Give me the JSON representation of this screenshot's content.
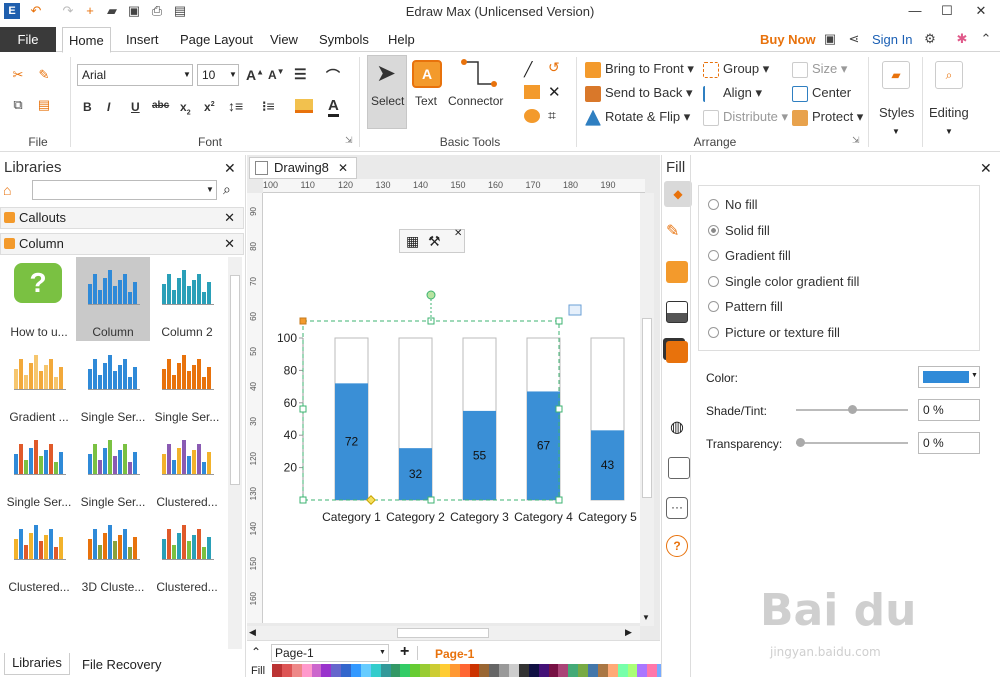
{
  "app": {
    "title": "Edraw Max (Unlicensed Version)"
  },
  "menu": {
    "file": "File",
    "tabs": [
      "Home",
      "Insert",
      "Page Layout",
      "View",
      "Symbols",
      "Help"
    ],
    "buy_now": "Buy Now",
    "sign_in": "Sign In"
  },
  "ribbon": {
    "font_family": "Arial",
    "font_size": "10",
    "groups": {
      "file": "File",
      "font": "Font",
      "basic_tools": "Basic Tools",
      "arrange": "Arrange"
    },
    "tools": {
      "select": "Select",
      "text": "Text",
      "connector": "Connector"
    },
    "arrange": {
      "bring_front": "Bring to Front",
      "send_back": "Send to Back",
      "rotate_flip": "Rotate & Flip",
      "group": "Group",
      "align": "Align",
      "distribute": "Distribute",
      "size": "Size",
      "center": "Center",
      "protect": "Protect"
    },
    "styles": "Styles",
    "editing": "Editing"
  },
  "libraries": {
    "title": "Libraries",
    "sections": [
      "Callouts",
      "Column"
    ],
    "items": [
      "How to u...",
      "Column",
      "Column 2",
      "Gradient ...",
      "Single Ser...",
      "Single Ser...",
      "Single Ser...",
      "Single Ser...",
      "Clustered...",
      "Clustered...",
      "3D Cluste...",
      "Clustered..."
    ],
    "bottom_tabs": [
      "Libraries",
      "File Recovery"
    ]
  },
  "document": {
    "tab": "Drawing8",
    "ruler_h": [
      "100",
      "110",
      "120",
      "130",
      "140",
      "150",
      "160",
      "170",
      "180",
      "190"
    ],
    "ruler_v": [
      "90",
      "80",
      "70",
      "60",
      "50",
      "40",
      "30",
      "120",
      "130",
      "140",
      "150",
      "160"
    ],
    "page_tab": "Page-1",
    "page_active": "Page-1",
    "fill_label": "Fill"
  },
  "chart_data": {
    "type": "bar",
    "categories": [
      "Category 1",
      "Category 2",
      "Category 3",
      "Category 4",
      "Category 5"
    ],
    "values": [
      72,
      32,
      55,
      67,
      43
    ],
    "ylim": [
      0,
      100
    ],
    "yticks": [
      20,
      40,
      60,
      80,
      100
    ],
    "color": "#3a8fd6"
  },
  "fill_panel": {
    "title": "Fill",
    "options": [
      "No fill",
      "Solid fill",
      "Gradient fill",
      "Single color gradient fill",
      "Pattern fill",
      "Picture or texture fill"
    ],
    "selected": "Solid fill",
    "color_label": "Color:",
    "color_value": "#2f8ad8",
    "shade_label": "Shade/Tint:",
    "shade_value": "0 %",
    "transparency_label": "Transparency:",
    "transparency_value": "0 %"
  }
}
